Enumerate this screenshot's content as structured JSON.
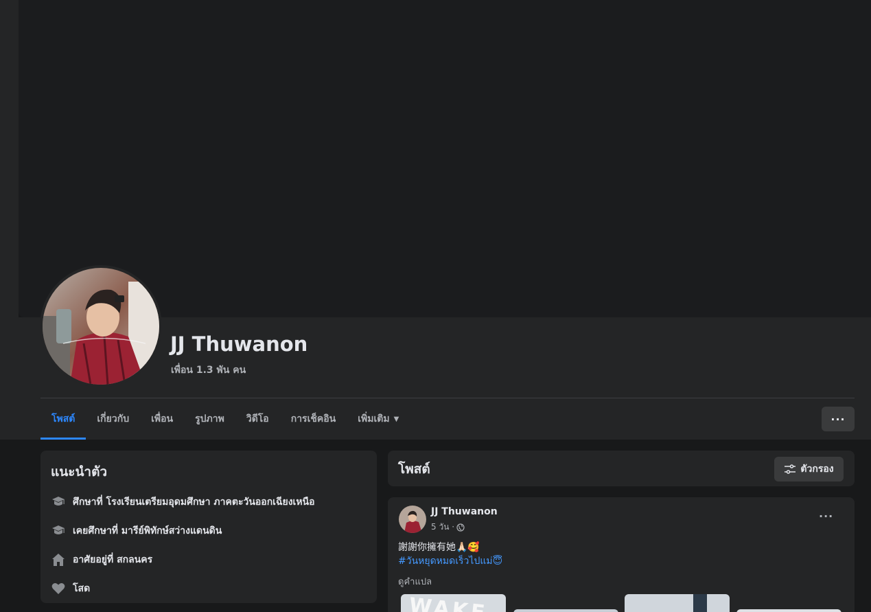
{
  "profile": {
    "name": "JJ Thuwanon",
    "friends": "เพื่อน 1.3 พัน คน"
  },
  "tabs": [
    {
      "label": "โพสต์",
      "active": true
    },
    {
      "label": "เกี่ยวกับ"
    },
    {
      "label": "เพื่อน"
    },
    {
      "label": "รูปภาพ"
    },
    {
      "label": "วิดีโอ"
    },
    {
      "label": "การเช็คอิน"
    },
    {
      "label": "เพิ่มเติม"
    }
  ],
  "more_button": "···",
  "intro": {
    "title": "แนะนำตัว",
    "items": [
      {
        "icon": "graduation-cap-icon",
        "text": "ศึกษาที่ โรงเรียนเตรียมอุดมศึกษา ภาคตะวันออกเฉียงเหนือ"
      },
      {
        "icon": "graduation-cap-icon",
        "text": "เคยศึกษาที่ มารีย์พิทักษ์สว่างแดนดิน"
      },
      {
        "icon": "home-icon",
        "text": "อาศัยอยู่ที่ สกลนคร"
      },
      {
        "icon": "heart-icon",
        "text": "โสด"
      }
    ]
  },
  "posts": {
    "title": "โพสต์",
    "filter_label": "ตัวกรอง"
  },
  "post": {
    "author": "JJ Thuwanon",
    "time": "5 วัน ·",
    "text": "謝謝你擁有她🙏🏻🥰",
    "hashtag": "#วันหยุดหมดเร็วไปแม่😇",
    "see_translation": "ดูคำแปล",
    "menu": "···"
  },
  "colors": {
    "accent": "#2d88ff",
    "link": "#4599ff",
    "panel": "#242526",
    "background": "#18191a"
  }
}
